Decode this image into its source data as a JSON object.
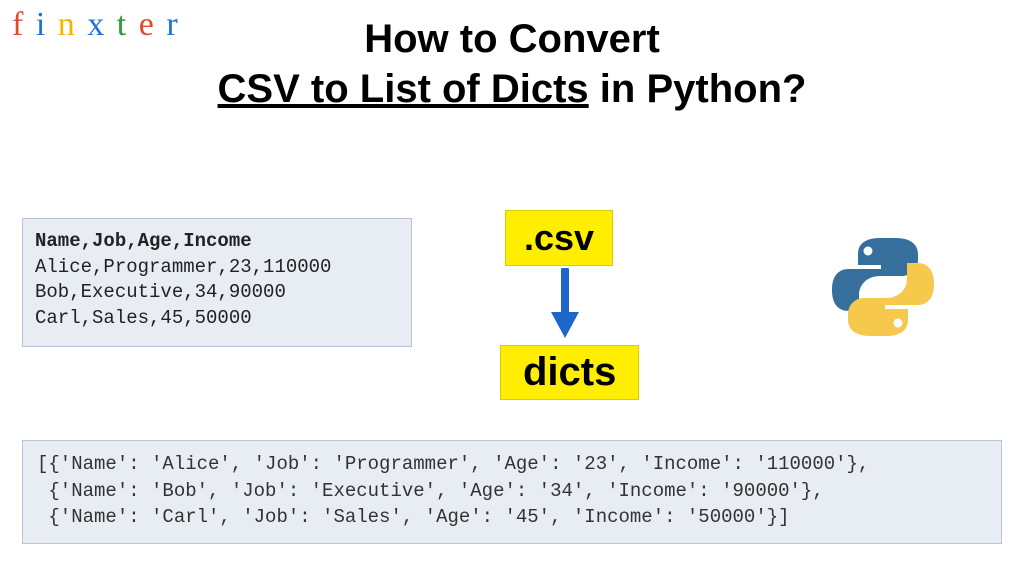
{
  "logo": {
    "letters": [
      "f",
      "i",
      "n",
      "x",
      "t",
      "e",
      "r"
    ],
    "colors": [
      "#e04a2f",
      "#1f74d4",
      "#f3b400",
      "#1f74d4",
      "#2e9a3a",
      "#e04a2f",
      "#1f74d4"
    ]
  },
  "title": {
    "line1": "How to Convert",
    "emph": "CSV to List of Dicts",
    "line2_suffix": " in Python?"
  },
  "csv_input": {
    "header": "Name,Job,Age,Income",
    "rows": [
      "Alice,Programmer,23,110000",
      "Bob,Executive,34,90000",
      "Carl,Sales,45,50000"
    ]
  },
  "badges": {
    "csv": ".csv",
    "dicts": "dicts"
  },
  "output_lines": [
    "[{'Name': 'Alice', 'Job': 'Programmer', 'Age': '23', 'Income': '110000'},",
    " {'Name': 'Bob', 'Job': 'Executive', 'Age': '34', 'Income': '90000'},",
    " {'Name': 'Carl', 'Job': 'Sales', 'Age': '45', 'Income': '50000'}]"
  ]
}
